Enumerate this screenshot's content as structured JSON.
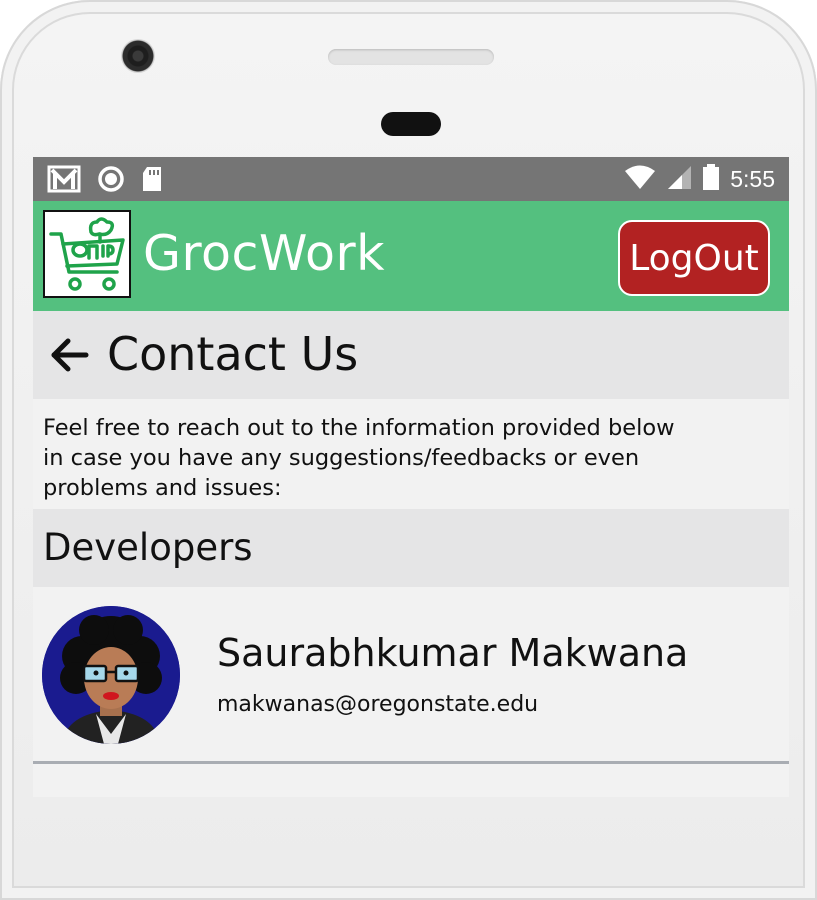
{
  "status_bar": {
    "time": "5:55",
    "left_icons": [
      "gmail-icon",
      "circle-icon",
      "sd-card-icon"
    ],
    "right_icons": [
      "wifi-icon",
      "signal-icon",
      "battery-icon"
    ]
  },
  "app_bar": {
    "title": "GrocWork",
    "logout_label": "LogOut",
    "logo_icon": "grocery-cart-logo",
    "color": "#54c07f",
    "logout_color": "#b22222"
  },
  "page": {
    "title": "Contact Us",
    "back_icon": "back-arrow-icon"
  },
  "intro": {
    "lines": [
      "Feel free to reach out to the information provided below",
      "in case you have any suggestions/feedbacks or even",
      "problems and issues:"
    ]
  },
  "developers": {
    "heading": "Developers",
    "items": [
      {
        "name": "Saurabhkumar Makwana",
        "email": "makwanas@oregonstate.edu",
        "avatar_icon": "developer-avatar"
      }
    ]
  }
}
